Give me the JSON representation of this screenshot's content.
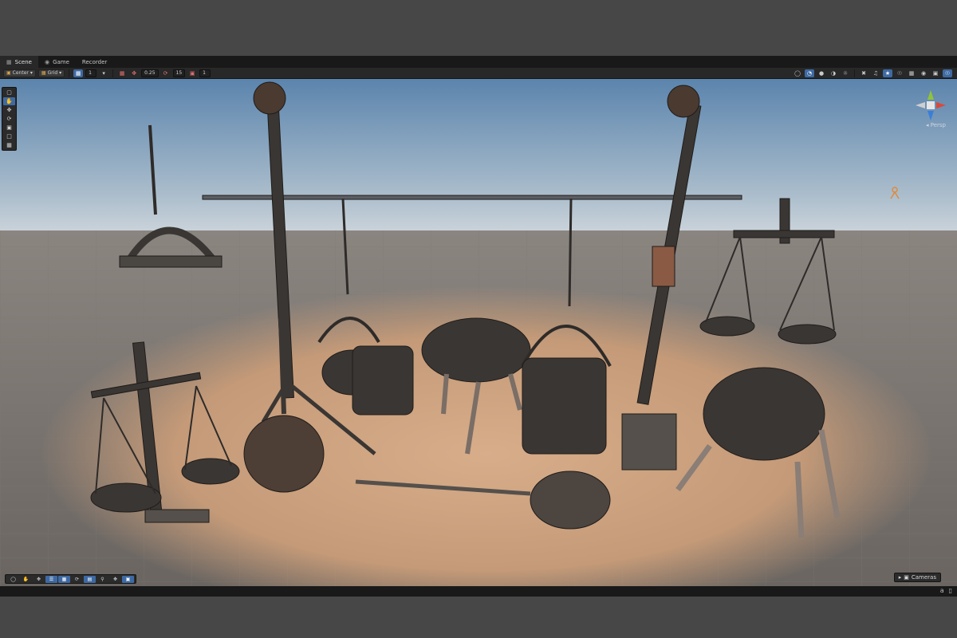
{
  "tabs": [
    {
      "label": "Scene",
      "icon": "scene-icon"
    },
    {
      "label": "Game",
      "icon": "gamepad-icon"
    },
    {
      "label": "Recorder",
      "icon": ""
    }
  ],
  "toolbar": {
    "pivot_label": "Center",
    "grid_label": "Grid",
    "grid_size": "1",
    "snap_move": "0.25",
    "snap_rotate": "15",
    "snap_scale": "1"
  },
  "viewport": {
    "projection_label": "Persp"
  },
  "overlay": {
    "cameras_label": "Cameras"
  },
  "colors": {
    "editor_bg": "#191919",
    "toolbar_bg": "#282828",
    "accent": "#3e6aa3",
    "sky_top": "#5b84ad",
    "sky_horizon": "#c9d2da",
    "ground": "#6f6a66"
  }
}
